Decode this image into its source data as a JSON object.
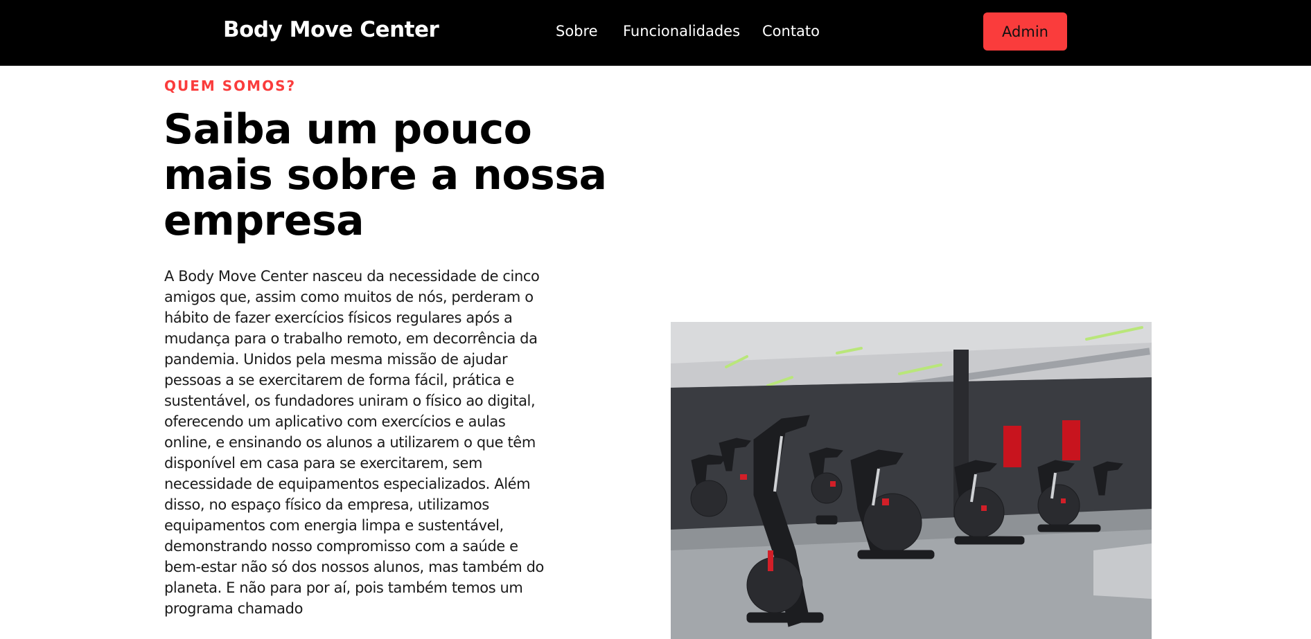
{
  "navbar": {
    "brand": "Body Move Center",
    "links": [
      "Sobre",
      "Funcionalidades",
      "Contato"
    ],
    "admin_label": "Admin"
  },
  "about": {
    "eyebrow": "QUEM SOMOS?",
    "heading": "Saiba um pouco mais sobre a nossa empresa",
    "paragraph": "A Body Move Center nasceu da necessidade de cinco amigos que, assim como muitos de nós, perderam o hábito de fazer exercícios físicos regulares após a mudança para o trabalho remoto, em decorrência da pandemia. Unidos pela mesma missão de ajudar pessoas a se exercitarem de forma fácil, prática e sustentável, os fundadores uniram o físico ao digital, oferecendo um aplicativo com exercícios e aulas online, e ensinando os alunos a utilizarem o que têm disponível em casa para se exercitarem, sem necessidade de equipamentos especializados. Além disso, no espaço físico da empresa, utilizamos equipamentos com energia limpa e sustentável, demonstrando nosso compromisso com a saúde e bem-estar não só dos nossos alunos, mas também do planeta. E não para por aí, pois também temos um programa chamado"
  },
  "colors": {
    "accent": "#fa3c3c",
    "navbar_bg": "#000000",
    "text": "#000000"
  },
  "image": {
    "icon": "gym-spin-bikes-photo"
  }
}
